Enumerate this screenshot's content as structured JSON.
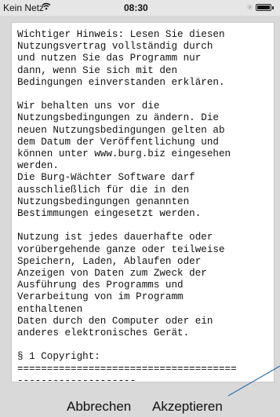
{
  "status_bar": {
    "carrier": "Kein Netz",
    "time": "08:30"
  },
  "document": {
    "text": "Wichtiger Hinweis: Lesen Sie diesen\nNutzungsvertrag vollständig durch\nund nutzen Sie das Programm nur\ndann, wenn Sie sich mit den\nBedingungen einverstanden erklären.\n\nWir behalten uns vor die\nNutzungsbedingungen zu ändern. Die\nneuen Nutzungsbedingungen gelten ab\ndem Datum der Veröffentlichung und\nkönnen unter www.burg.biz eingesehen\nwerden.\nDie Burg-Wächter Software darf\nausschließlich für die in den\nNutzungsbedingungen genannten\nBestimmungen eingesetzt werden.\n\nNutzung ist jedes dauerhafte oder\nvorübergehende ganze oder teilweise\nSpeichern, Laden, Ablaufen oder\nAnzeigen von Daten zum Zweck der\nAusführung des Programms und\nVerarbeitung von im Programm\nenthaltenen\nDaten durch den Computer oder ein\nanderes elektronisches Gerät.\n\n§ 1 Copyright:\n=====================================\n--------------------"
  },
  "buttons": {
    "cancel": "Abbrechen",
    "accept": "Akzeptieren"
  }
}
